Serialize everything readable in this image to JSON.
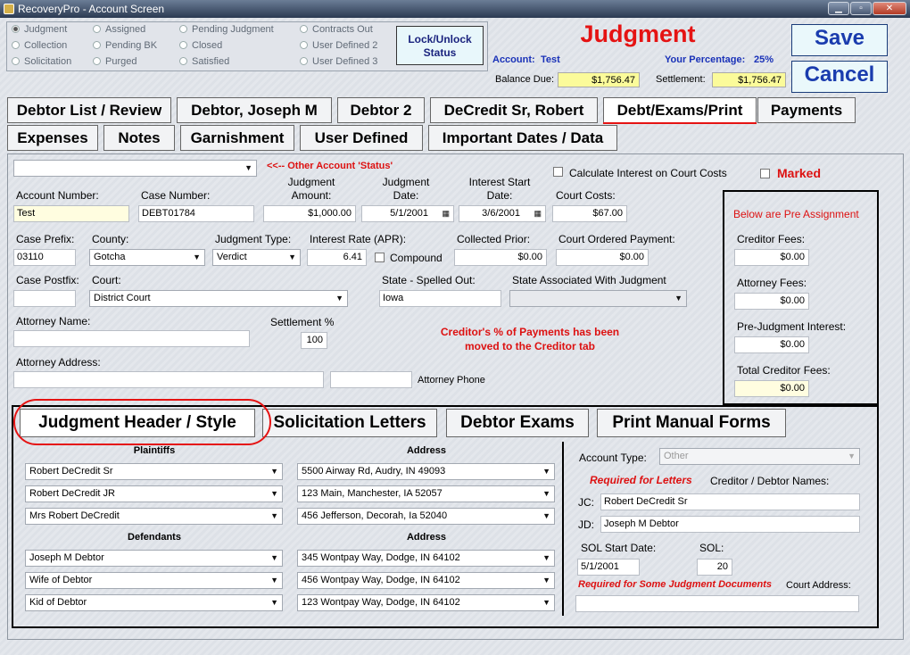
{
  "window": {
    "title": "RecoveryPro - Account Screen",
    "minimize": "▁",
    "restore": "▫",
    "close": "✕"
  },
  "status_options": [
    {
      "label": "Judgment",
      "selected": true
    },
    {
      "label": "Collection",
      "selected": false
    },
    {
      "label": "Solicitation",
      "selected": false
    },
    {
      "label": "Assigned",
      "selected": false
    },
    {
      "label": "Pending BK",
      "selected": false
    },
    {
      "label": "Purged",
      "selected": false
    },
    {
      "label": "Pending Judgment",
      "selected": false
    },
    {
      "label": "Closed",
      "selected": false
    },
    {
      "label": "Satisfied",
      "selected": false
    },
    {
      "label": "Contracts Out",
      "selected": false
    },
    {
      "label": "User Defined 2",
      "selected": false
    },
    {
      "label": "User Defined 3",
      "selected": false
    }
  ],
  "lock_button": "Lock/Unlock Status",
  "header": {
    "title": "Judgment",
    "account_label": "Account:",
    "account_value": "Test",
    "percentage_label": "Your Percentage:",
    "percentage_value": "25%",
    "balance_label": "Balance Due:",
    "balance_value": "$1,756.47",
    "settlement_label": "Settlement:",
    "settlement_value": "$1,756.47"
  },
  "actions": {
    "save": "Save",
    "cancel": "Cancel"
  },
  "tabs_row1": [
    "Debtor List / Review",
    "Debtor, Joseph M",
    "Debtor 2",
    "DeCredit Sr, Robert",
    "Debt/Exams/Print",
    "Payments"
  ],
  "tabs_row2": [
    "Expenses",
    "Notes",
    "Garnishment",
    "User Defined",
    "Important Dates / Data"
  ],
  "form": {
    "other_status_note": "<<-- Other Account 'Status'",
    "calc_interest": "Calculate Interest on Court Costs",
    "marked": "Marked",
    "account_number_label": "Account Number:",
    "account_number": "Test",
    "case_number_label": "Case Number:",
    "case_number": "DEBT01784",
    "judgment_amount_label": "Judgment Amount:",
    "judgment_amount": "$1,000.00",
    "judgment_date_label": "Judgment Date:",
    "judgment_date": "5/1/2001",
    "interest_start_label": "Interest Start Date:",
    "interest_start": "3/6/2001",
    "court_costs_label": "Court Costs:",
    "court_costs": "$67.00",
    "case_prefix_label": "Case Prefix:",
    "case_prefix": "03110",
    "county_label": "County:",
    "county": "Gotcha",
    "judgment_type_label": "Judgment Type:",
    "judgment_type": "Verdict",
    "interest_rate_label": "Interest Rate (APR):",
    "interest_rate": "6.41",
    "compound_label": "Compound",
    "collected_prior_label": "Collected  Prior:",
    "collected_prior": "$0.00",
    "court_ordered_label": "Court Ordered Payment:",
    "court_ordered": "$0.00",
    "case_postfix_label": "Case Postfix:",
    "court_label": "Court:",
    "court": "District Court",
    "state_spelled_label": "State - Spelled Out:",
    "state_spelled": "Iowa",
    "state_assoc_label": "State Associated With Judgment",
    "attorney_name_label": "Attorney Name:",
    "settlement_pct_label": "Settlement %",
    "settlement_pct": "100",
    "creditor_note": "Creditor's % of Payments has been moved to the Creditor tab",
    "attorney_address_label": "Attorney Address:",
    "attorney_phone_label": "Attorney Phone"
  },
  "pre_assignment": {
    "title": "Below are Pre Assignment",
    "creditor_fees_label": "Creditor Fees:",
    "creditor_fees": "$0.00",
    "attorney_fees_label": "Attorney Fees:",
    "attorney_fees": "$0.00",
    "prejudgment_label": "Pre-Judgment Interest:",
    "prejudgment": "$0.00",
    "total_label": "Total Creditor Fees:",
    "total": "$0.00"
  },
  "subtabs": [
    "Judgment Header / Style",
    "Solicitation Letters",
    "Debtor Exams",
    "Print Manual Forms"
  ],
  "header_style": {
    "plaintiffs_label": "Plaintiffs",
    "address_label": "Address",
    "defendants_label": "Defendants",
    "plaintiffs": [
      {
        "name": "Robert DeCredit Sr",
        "address": "5500 Airway Rd, Audry, IN 49093"
      },
      {
        "name": "Robert DeCredit JR",
        "address": "123 Main, Manchester, IA 52057"
      },
      {
        "name": "Mrs Robert DeCredit",
        "address": "456 Jefferson, Decorah, Ia 52040"
      }
    ],
    "defendants": [
      {
        "name": "Joseph M Debtor",
        "address": "345 Wontpay Way, Dodge, IN 64102"
      },
      {
        "name": "Wife of Debtor",
        "address": "456 Wontpay Way, Dodge, IN 64102"
      },
      {
        "name": "Kid of Debtor",
        "address": "123 Wontpay Way, Dodge, IN 64102"
      }
    ]
  },
  "right_panel": {
    "account_type_label": "Account Type:",
    "account_type": "Other",
    "required_letters": "Required for Letters",
    "names_label": "Creditor / Debtor Names:",
    "jc_label": "JC:",
    "jc": "Robert DeCredit Sr",
    "jd_label": "JD:",
    "jd": "Joseph M Debtor",
    "sol_start_label": "SOL Start Date:",
    "sol_start": "5/1/2001",
    "sol_label": "SOL:",
    "sol": "20",
    "required_docs": "Required for Some Judgment Documents",
    "court_address_label": "Court Address:"
  },
  "icons": {
    "dropdown": "▼",
    "calendar": "▦"
  }
}
